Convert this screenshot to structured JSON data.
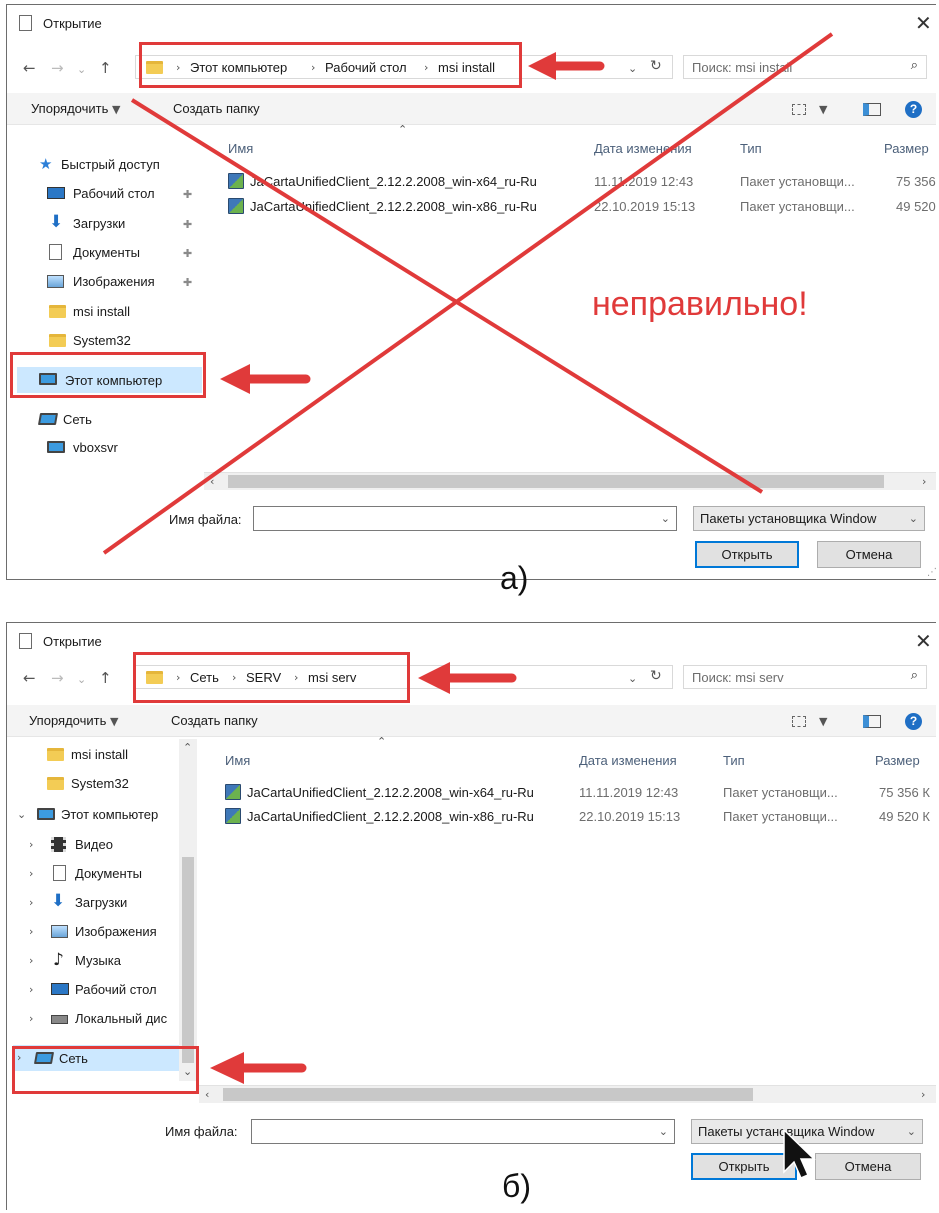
{
  "dialog_a": {
    "title": "Открытие",
    "breadcrumb": [
      "Этот компьютер",
      "Рабочий стол",
      "msi install"
    ],
    "search_placeholder": "Поиск: msi install",
    "toolbar": {
      "organize": "Упорядочить",
      "new_folder": "Создать папку"
    },
    "nav_items": [
      {
        "label": "Быстрый доступ",
        "icon": "star-icon"
      },
      {
        "label": "Рабочий стол",
        "icon": "desktop-icon",
        "pinned": true
      },
      {
        "label": "Загрузки",
        "icon": "download-icon",
        "pinned": true
      },
      {
        "label": "Документы",
        "icon": "document-icon",
        "pinned": true
      },
      {
        "label": "Изображения",
        "icon": "pictures-icon",
        "pinned": true
      },
      {
        "label": "msi install",
        "icon": "folder-icon"
      },
      {
        "label": "System32",
        "icon": "folder-icon"
      },
      {
        "label": "Этот компьютер",
        "icon": "computer-icon",
        "selected": true
      },
      {
        "label": "Сеть",
        "icon": "network-icon"
      },
      {
        "label": "vboxsvr",
        "icon": "computer-icon"
      }
    ],
    "columns": {
      "name": "Имя",
      "date": "Дата изменения",
      "type": "Тип",
      "size": "Размер"
    },
    "files": [
      {
        "name": "JaCartaUnifiedClient_2.12.2.2008_win-x64_ru-Ru",
        "date": "11.11.2019 12:43",
        "type": "Пакет установщи...",
        "size": "75 356"
      },
      {
        "name": "JaCartaUnifiedClient_2.12.2.2008_win-x86_ru-Ru",
        "date": "22.10.2019 15:13",
        "type": "Пакет установщи...",
        "size": "49 520"
      }
    ],
    "filename_label": "Имя файла:",
    "filename_value": "",
    "filter": "Пакеты установщика Window",
    "open_button": "Открыть",
    "cancel_button": "Отмена",
    "wrong_label": "неправильно!"
  },
  "dialog_b": {
    "title": "Открытие",
    "breadcrumb": [
      "Сеть",
      "SERV",
      "msi serv"
    ],
    "search_placeholder": "Поиск: msi serv",
    "toolbar": {
      "organize": "Упорядочить",
      "new_folder": "Создать папку"
    },
    "nav_items": [
      {
        "label": "msi install",
        "icon": "folder-icon"
      },
      {
        "label": "System32",
        "icon": "folder-icon"
      },
      {
        "label": "Этот компьютер",
        "icon": "computer-icon",
        "expanded": true
      },
      {
        "label": "Видео",
        "icon": "video-icon"
      },
      {
        "label": "Документы",
        "icon": "document-icon"
      },
      {
        "label": "Загрузки",
        "icon": "download-icon"
      },
      {
        "label": "Изображения",
        "icon": "pictures-icon"
      },
      {
        "label": "Музыка",
        "icon": "music-icon"
      },
      {
        "label": "Рабочий стол",
        "icon": "desktop-icon"
      },
      {
        "label": "Локальный дис",
        "icon": "drive-icon"
      },
      {
        "label": "Сеть",
        "icon": "network-icon",
        "selected": true
      }
    ],
    "columns": {
      "name": "Имя",
      "date": "Дата изменения",
      "type": "Тип",
      "size": "Размер"
    },
    "files": [
      {
        "name": "JaCartaUnifiedClient_2.12.2.2008_win-x64_ru-Ru",
        "date": "11.11.2019 12:43",
        "type": "Пакет установщи...",
        "size": "75 356 К"
      },
      {
        "name": "JaCartaUnifiedClient_2.12.2.2008_win-x86_ru-Ru",
        "date": "22.10.2019 15:13",
        "type": "Пакет установщи...",
        "size": "49 520 К"
      }
    ],
    "filename_label": "Имя файла:",
    "filename_value": "",
    "filter": "Пакеты установщика Window",
    "open_button": "Открыть",
    "cancel_button": "Отмена"
  },
  "captions": {
    "a": "а)",
    "b": "б)"
  },
  "colors": {
    "annotation_red": "#e03a3a",
    "selection_blue": "#cce8ff",
    "accent": "#0078d7"
  }
}
